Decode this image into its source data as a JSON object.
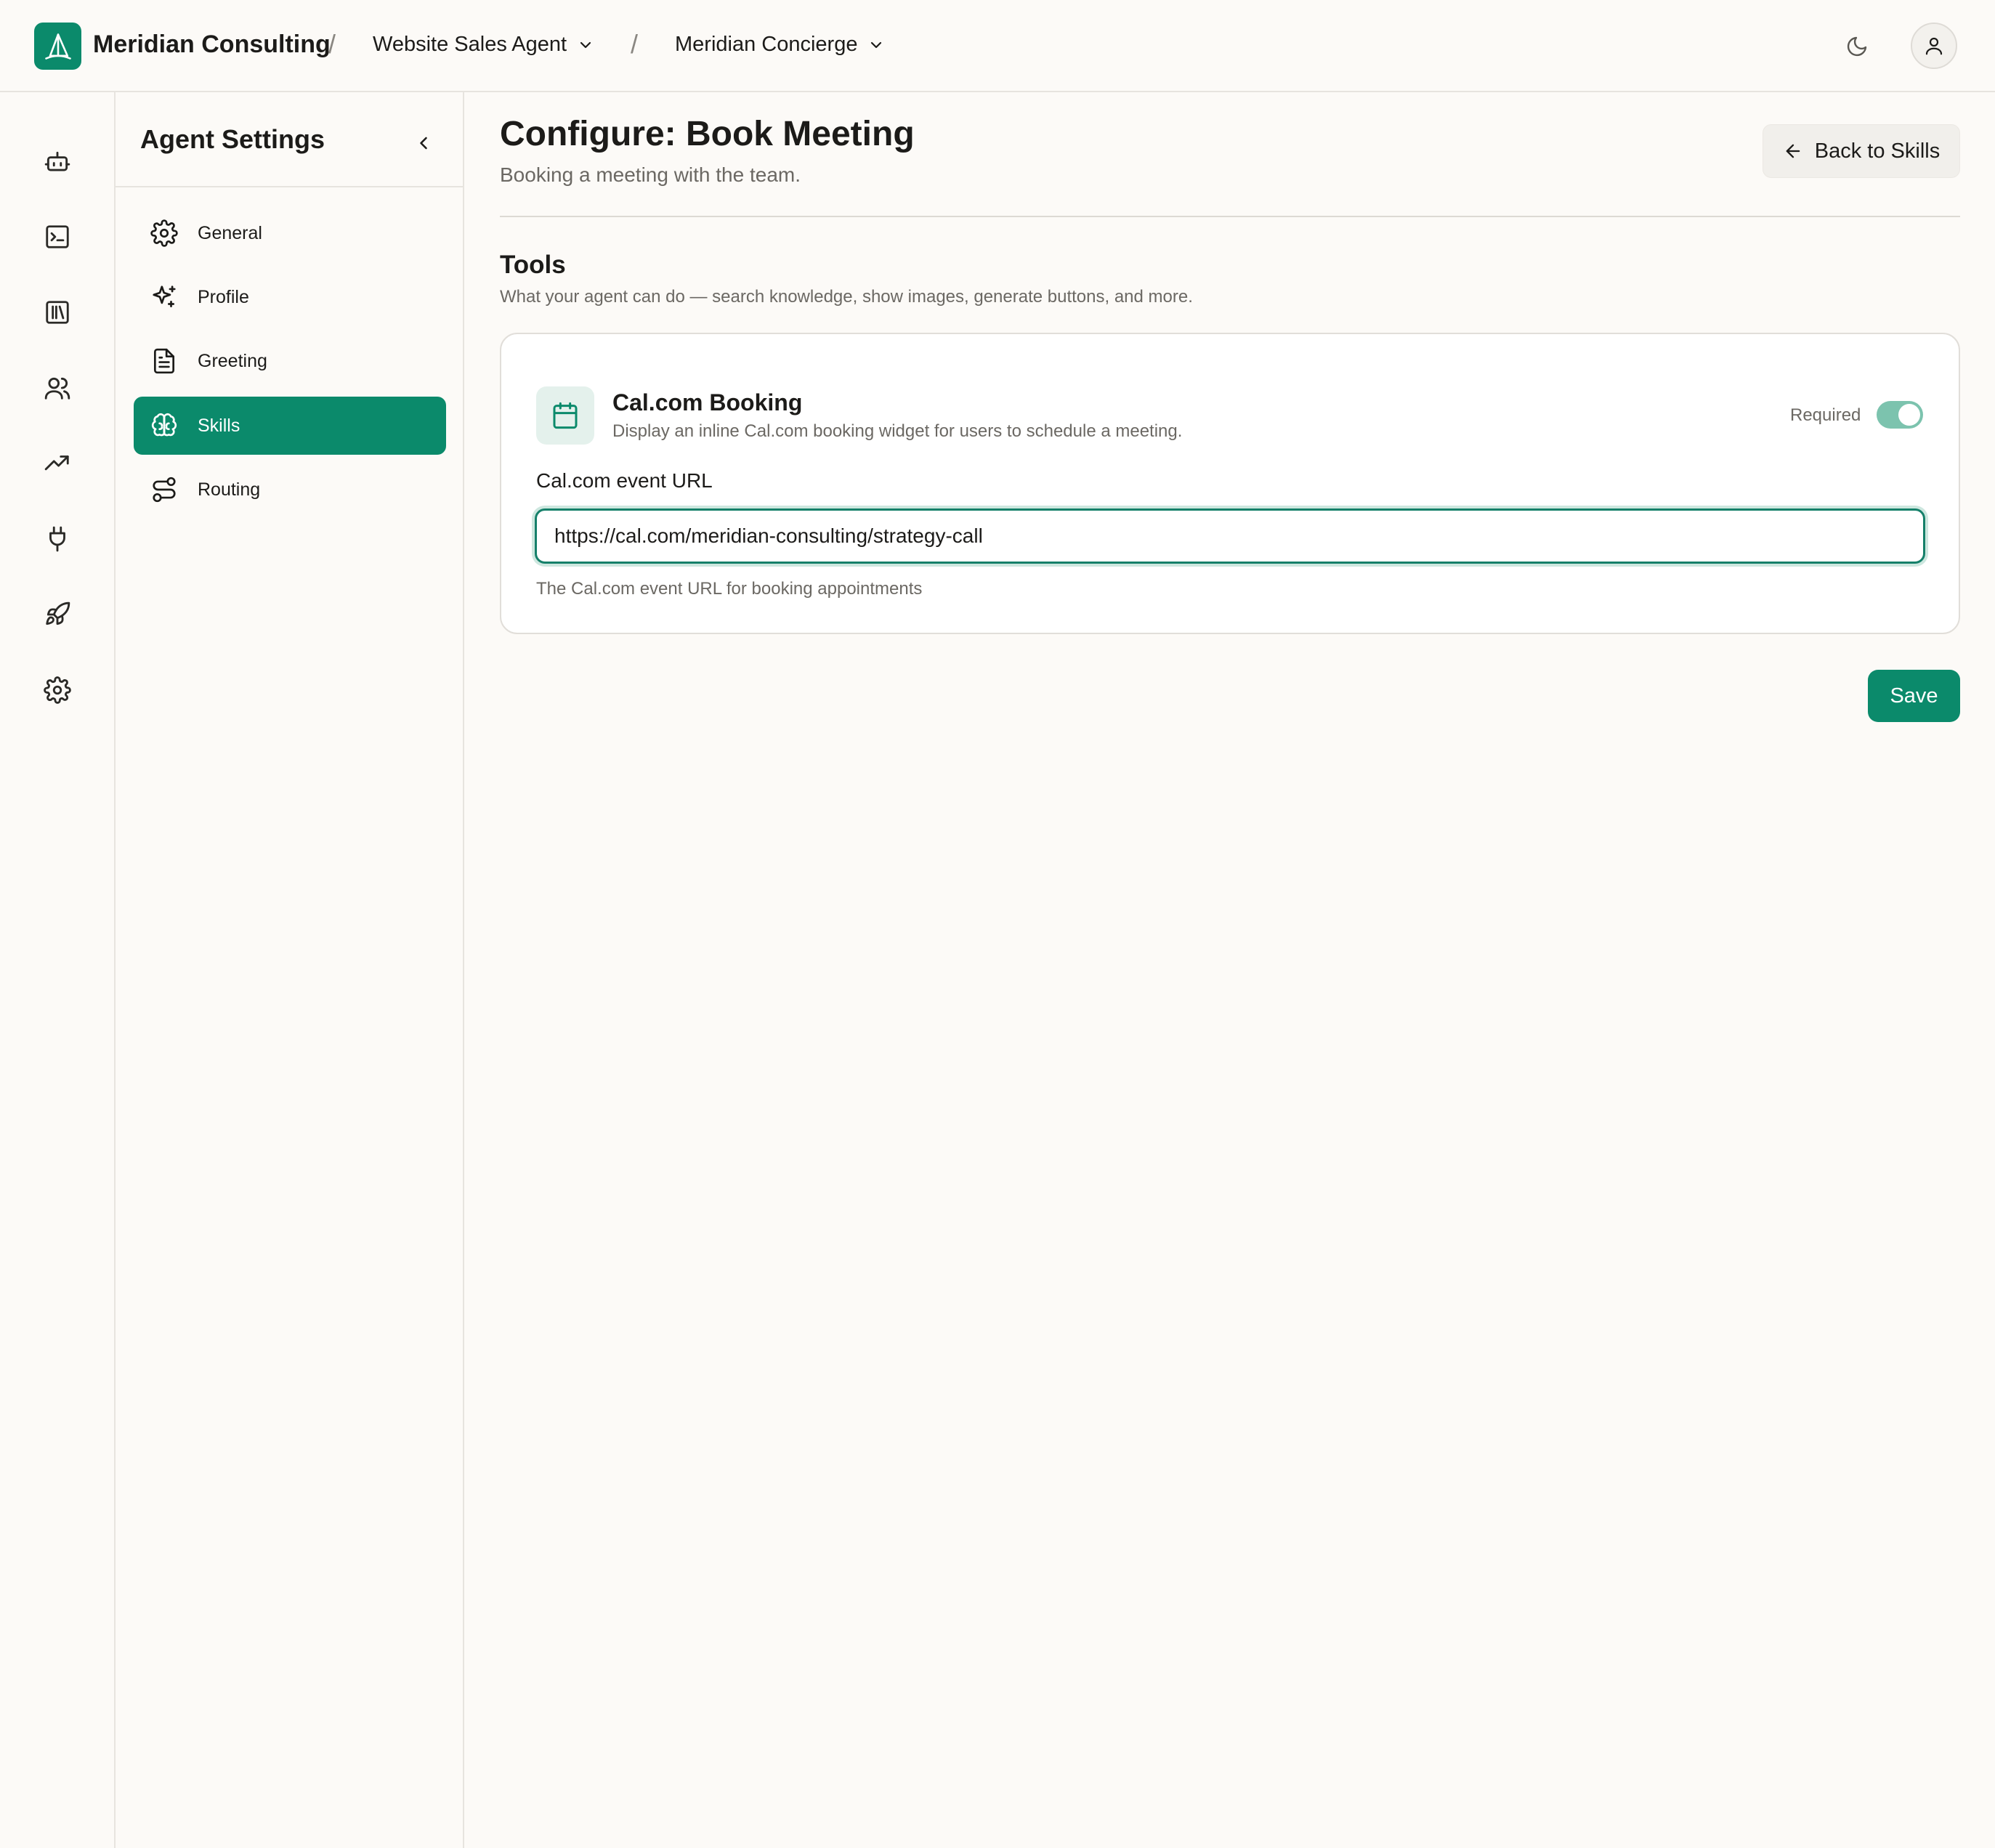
{
  "header": {
    "brand": "Meridian Consulting",
    "separator": "/",
    "agent_selector": "Website Sales Agent",
    "persona_selector": "Meridian Concierge",
    "icons": [
      "logo-sail-icon",
      "chevron-down-icon",
      "moon-icon",
      "user-icon"
    ]
  },
  "rail": {
    "icons": [
      "bot-icon",
      "terminal-icon",
      "library-icon",
      "users-icon",
      "trending-up-icon",
      "plug-icon",
      "rocket-icon",
      "gear-icon"
    ]
  },
  "sidebar": {
    "title": "Agent Settings",
    "items": [
      {
        "label": "General",
        "icon": "gear-icon",
        "active": false
      },
      {
        "label": "Profile",
        "icon": "sparkles-icon",
        "active": false
      },
      {
        "label": "Greeting",
        "icon": "document-icon",
        "active": false
      },
      {
        "label": "Skills",
        "icon": "brain-icon",
        "active": true
      },
      {
        "label": "Routing",
        "icon": "route-icon",
        "active": false
      }
    ]
  },
  "main": {
    "title": "Configure: Book Meeting",
    "subtitle": "Booking a meeting with the team.",
    "back_button": "Back to Skills",
    "tools_section": {
      "title": "Tools",
      "subtitle": "What your agent can do — search knowledge, show images, generate buttons, and more."
    },
    "tool": {
      "icon": "calendar-icon",
      "name": "Cal.com Booking",
      "description": "Display an inline Cal.com booking widget for users to schedule a meeting.",
      "required_label": "Required",
      "required": true,
      "field_label": "Cal.com event URL",
      "field_value": "https://cal.com/meridian-consulting/strategy-call",
      "field_help": "The Cal.com event URL for booking appointments"
    },
    "save_button": "Save"
  },
  "colors": {
    "accent": "#0b8a6b",
    "background": "#fcfaf7",
    "toggle_on": "#7cc3ae",
    "icon_tile": "#e4f1ec"
  }
}
